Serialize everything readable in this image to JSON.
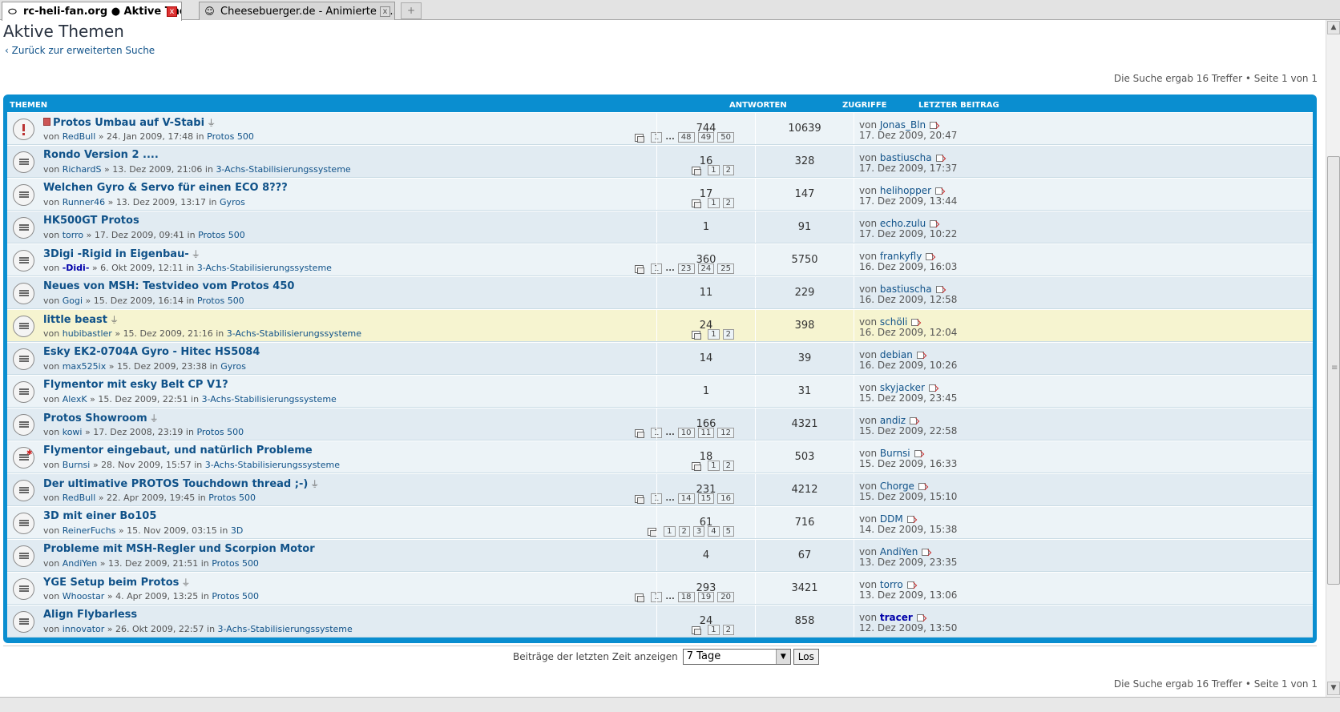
{
  "browser": {
    "tabs": [
      {
        "title": "rc-heli-fan.org ● Aktive The...",
        "icon": "site-icon"
      },
      {
        "title": "Cheesebuerger.de - Animierte S...",
        "icon": "smiley-icon"
      }
    ],
    "close_label": "x",
    "new_tab_label": "+"
  },
  "page": {
    "title": "Aktive Themen",
    "back_link": "Zurück zur erweiterten Suche",
    "results_text": "Die Suche ergab 16 Treffer • Seite 1 von 1"
  },
  "table": {
    "headers": {
      "topics": "Themen",
      "replies": "Antworten",
      "views": "Zugriffe",
      "last_post": "Letzter Beitrag"
    },
    "rows": [
      {
        "title": "Protos Umbau auf V-Stabi",
        "sticky": true,
        "attach": true,
        "icon": "hot",
        "author": "RedBull",
        "date": "24. Jan 2009, 17:48",
        "forum": "Protos 500",
        "pages": [
          "1",
          "...",
          "48",
          "49",
          "50"
        ],
        "replies": "744",
        "views": "10639",
        "last_user": "Jonas_Bln",
        "last_date": "17. Dez 2009, 20:47"
      },
      {
        "title": "Rondo Version 2 ....",
        "author": "RichardS",
        "date": "13. Dez 2009, 21:06",
        "forum": "3-Achs-Stabilisierungssysteme",
        "pages": [
          "1",
          "2"
        ],
        "replies": "16",
        "views": "328",
        "last_user": "bastiuscha",
        "last_date": "17. Dez 2009, 17:37"
      },
      {
        "title": "Welchen Gyro & Servo für einen ECO 8???",
        "author": "Runner46",
        "date": "13. Dez 2009, 13:17",
        "forum": "Gyros",
        "pages": [
          "1",
          "2"
        ],
        "replies": "17",
        "views": "147",
        "last_user": "helihopper",
        "last_date": "17. Dez 2009, 13:44"
      },
      {
        "title": "HK500GT Protos",
        "author": "torro",
        "date": "17. Dez 2009, 09:41",
        "forum": "Protos 500",
        "pages": [],
        "replies": "1",
        "views": "91",
        "last_user": "echo.zulu",
        "last_date": "17. Dez 2009, 10:22"
      },
      {
        "title": "3Digi -Rigid in Eigenbau-",
        "attach": true,
        "author": "-Didi-",
        "author_bold": true,
        "date": "6. Okt 2009, 12:11",
        "forum": "3-Achs-Stabilisierungssysteme",
        "pages": [
          "1",
          "...",
          "23",
          "24",
          "25"
        ],
        "replies": "360",
        "views": "5750",
        "last_user": "frankyfly",
        "last_date": "16. Dez 2009, 16:03"
      },
      {
        "title": "Neues von MSH: Testvideo vom Protos 450",
        "author": "Gogi",
        "date": "15. Dez 2009, 16:14",
        "forum": "Protos 500",
        "pages": [],
        "replies": "11",
        "views": "229",
        "last_user": "bastiuscha",
        "last_date": "16. Dez 2009, 12:58"
      },
      {
        "title": "little beast",
        "attach": true,
        "highlight": true,
        "author": "hubibastler",
        "date": "15. Dez 2009, 21:16",
        "forum": "3-Achs-Stabilisierungssysteme",
        "pages": [
          "1",
          "2"
        ],
        "replies": "24",
        "views": "398",
        "last_user": "schöli",
        "last_date": "16. Dez 2009, 12:04"
      },
      {
        "title": "Esky EK2-0704A Gyro - Hitec HS5084",
        "author": "max525ix",
        "date": "15. Dez 2009, 23:38",
        "forum": "Gyros",
        "pages": [],
        "replies": "14",
        "views": "39",
        "last_user": "debian",
        "last_date": "16. Dez 2009, 10:26"
      },
      {
        "title": "Flymentor mit esky Belt CP V1?",
        "author": "AlexK",
        "date": "15. Dez 2009, 22:51",
        "forum": "3-Achs-Stabilisierungssysteme",
        "pages": [],
        "replies": "1",
        "views": "31",
        "last_user": "skyjacker",
        "last_date": "15. Dez 2009, 23:45"
      },
      {
        "title": "Protos Showroom",
        "attach": true,
        "author": "kowi",
        "date": "17. Dez 2008, 23:19",
        "forum": "Protos 500",
        "pages": [
          "1",
          "...",
          "10",
          "11",
          "12"
        ],
        "replies": "166",
        "views": "4321",
        "last_user": "andiz",
        "last_date": "15. Dez 2009, 22:58"
      },
      {
        "title": "Flymentor eingebaut, und natürlich Probleme",
        "icon": "star",
        "author": "Burnsi",
        "date": "28. Nov 2009, 15:57",
        "forum": "3-Achs-Stabilisierungssysteme",
        "pages": [
          "1",
          "2"
        ],
        "replies": "18",
        "views": "503",
        "last_user": "Burnsi",
        "last_date": "15. Dez 2009, 16:33"
      },
      {
        "title": "Der ultimative PROTOS Touchdown thread ;-)",
        "attach": true,
        "author": "RedBull",
        "date": "22. Apr 2009, 19:45",
        "forum": "Protos 500",
        "pages": [
          "1",
          "...",
          "14",
          "15",
          "16"
        ],
        "replies": "231",
        "views": "4212",
        "last_user": "Chorge",
        "last_date": "15. Dez 2009, 15:10"
      },
      {
        "title": "3D mit einer Bo105",
        "author": "ReinerFuchs",
        "date": "15. Nov 2009, 03:15",
        "forum": "3D",
        "pages": [
          "1",
          "2",
          "3",
          "4",
          "5"
        ],
        "replies": "61",
        "views": "716",
        "last_user": "DDM",
        "last_date": "14. Dez 2009, 15:38"
      },
      {
        "title": "Probleme mit MSH-Regler und Scorpion Motor",
        "author": "AndiYen",
        "date": "13. Dez 2009, 21:51",
        "forum": "Protos 500",
        "pages": [],
        "replies": "4",
        "views": "67",
        "last_user": "AndiYen",
        "last_date": "13. Dez 2009, 23:35"
      },
      {
        "title": "YGE Setup beim Protos",
        "attach": true,
        "author": "Whoostar",
        "date": "4. Apr 2009, 13:25",
        "forum": "Protos 500",
        "pages": [
          "1",
          "...",
          "18",
          "19",
          "20"
        ],
        "replies": "293",
        "views": "3421",
        "last_user": "torro",
        "last_date": "13. Dez 2009, 13:06"
      },
      {
        "title": "Align Flybarless",
        "author": "innovator",
        "date": "26. Okt 2009, 22:57",
        "forum": "3-Achs-Stabilisierungssysteme",
        "pages": [
          "1",
          "2"
        ],
        "replies": "24",
        "views": "858",
        "last_user": "tracer",
        "last_user_bold": true,
        "last_date": "12. Dez 2009, 13:50"
      }
    ]
  },
  "labels": {
    "by": "von",
    "in": "in",
    "sep": "»",
    "attach_glyph": "⏚"
  },
  "filter": {
    "label": "Beiträge der letzten Zeit anzeigen",
    "selected": "7 Tage",
    "button": "Los"
  },
  "colors": {
    "accent": "#0a8ed0",
    "link": "#105289",
    "highlight_row": "#f6f4d0"
  }
}
